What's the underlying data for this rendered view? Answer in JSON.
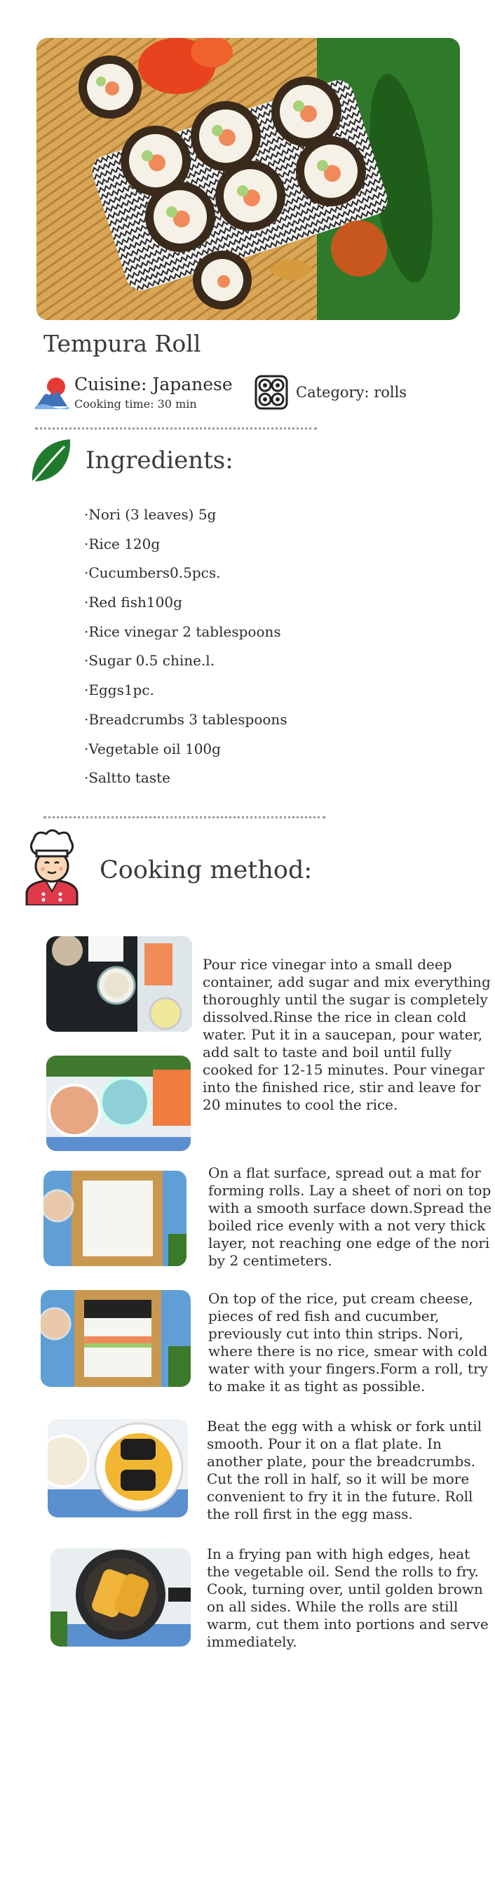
{
  "recipe": {
    "title": "Tempura Roll",
    "cuisine": "Cuisine: Japanese",
    "cooking_time": "Cooking time: 30 min",
    "category": "Category: rolls"
  },
  "ingredients": {
    "heading": "Ingredients:",
    "items": [
      "·Nori (3 leaves) 5g",
      "·Rice 120g",
      "·Cucumbers0.5pcs.",
      "·Red fish100g",
      "·Rice vinegar 2 tablespoons",
      "·Sugar 0.5 chine.l.",
      "·Eggs1pc.",
      "·Breadcrumbs 3 tablespoons",
      "·Vegetable oil 100g",
      "·Saltto taste"
    ]
  },
  "method": {
    "heading": "Cooking method:",
    "steps": [
      "Pour rice vinegar into a small deep container, add sugar and mix everything thoroughly until the sugar is completely dissolved.Rinse the rice in clean cold water. Put it in a saucepan, pour water, add salt to taste and boil until fully cooked for 12-15 minutes. Pour vinegar into the finished rice, stir and leave for 20 minutes to cool the rice.",
      "On a flat surface, spread out a mat for forming rolls. Lay a sheet of nori on top with a smooth surface down.Spread the boiled rice evenly with a not very thick layer, not reaching one edge of the nori by 2 centimeters.",
      "On top of the rice, put cream cheese, pieces of red fish and cucumber, previously cut into thin strips. Nori, where there is no rice, smear with cold water with your fingers.Form a roll, try to make it as tight as possible.",
      "Beat the egg with a whisk or fork until smooth. Pour it on a flat plate. In another plate, pour the breadcrumbs. Cut the roll in half, so it will be more convenient to fry it in the future. Roll the roll first in the egg mass.",
      "In a frying pan with high edges, heat the vegetable oil. Send the rolls to fry. Cook, turning over, until golden brown on all sides. While the rolls are still warm, cut them into portions and serve immediately."
    ]
  },
  "icons": {
    "cuisine": "mount-fuji-icon",
    "category": "sushi-rolls-icon",
    "ingredients": "leaf-icon",
    "method": "chef-icon"
  },
  "colors": {
    "leaf": "#1f7a2e",
    "chef_red": "#e0394a",
    "text": "#2b2b2b"
  }
}
